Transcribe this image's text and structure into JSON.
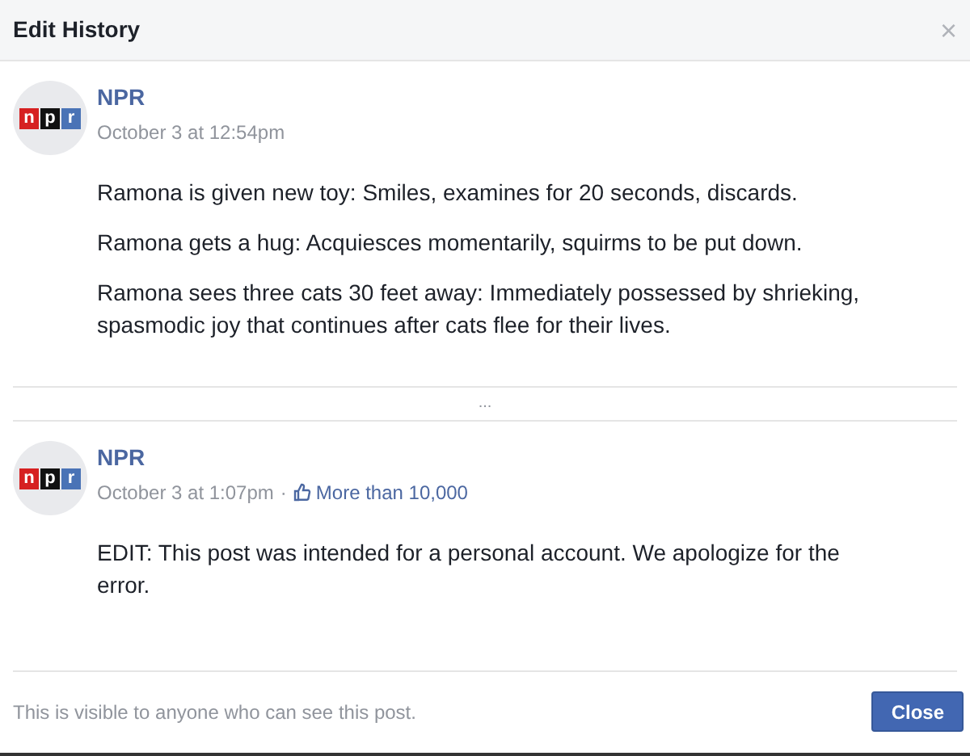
{
  "dialog": {
    "title": "Edit History",
    "close_symbol": "×"
  },
  "revisions": [
    {
      "author": "NPR",
      "logo": [
        {
          "letter": "n",
          "color": "#d62021"
        },
        {
          "letter": "p",
          "color": "#111111"
        },
        {
          "letter": "r",
          "color": "#4a73b6"
        }
      ],
      "date": "October 3 at 12:54pm",
      "paragraphs": [
        "Ramona is given new toy: Smiles, examines for 20 seconds, discards.",
        "Ramona gets a hug: Acquiesces momentarily, squirms to be put down.",
        "Ramona sees three cats 30 feet away: Immediately possessed by shrieking, spasmodic joy that continues after cats flee for their lives."
      ]
    },
    {
      "author": "NPR",
      "logo": [
        {
          "letter": "n",
          "color": "#d62021"
        },
        {
          "letter": "p",
          "color": "#111111"
        },
        {
          "letter": "r",
          "color": "#4a73b6"
        }
      ],
      "date": "October 3 at 1:07pm",
      "separator": "·",
      "reactions": "More than 10,000",
      "paragraphs": [
        "EDIT: This post was intended for a personal account. We apologize for the error."
      ]
    }
  ],
  "more_marker": "...",
  "footer": {
    "note": "This is visible to anyone who can see this post.",
    "button": "Close"
  }
}
